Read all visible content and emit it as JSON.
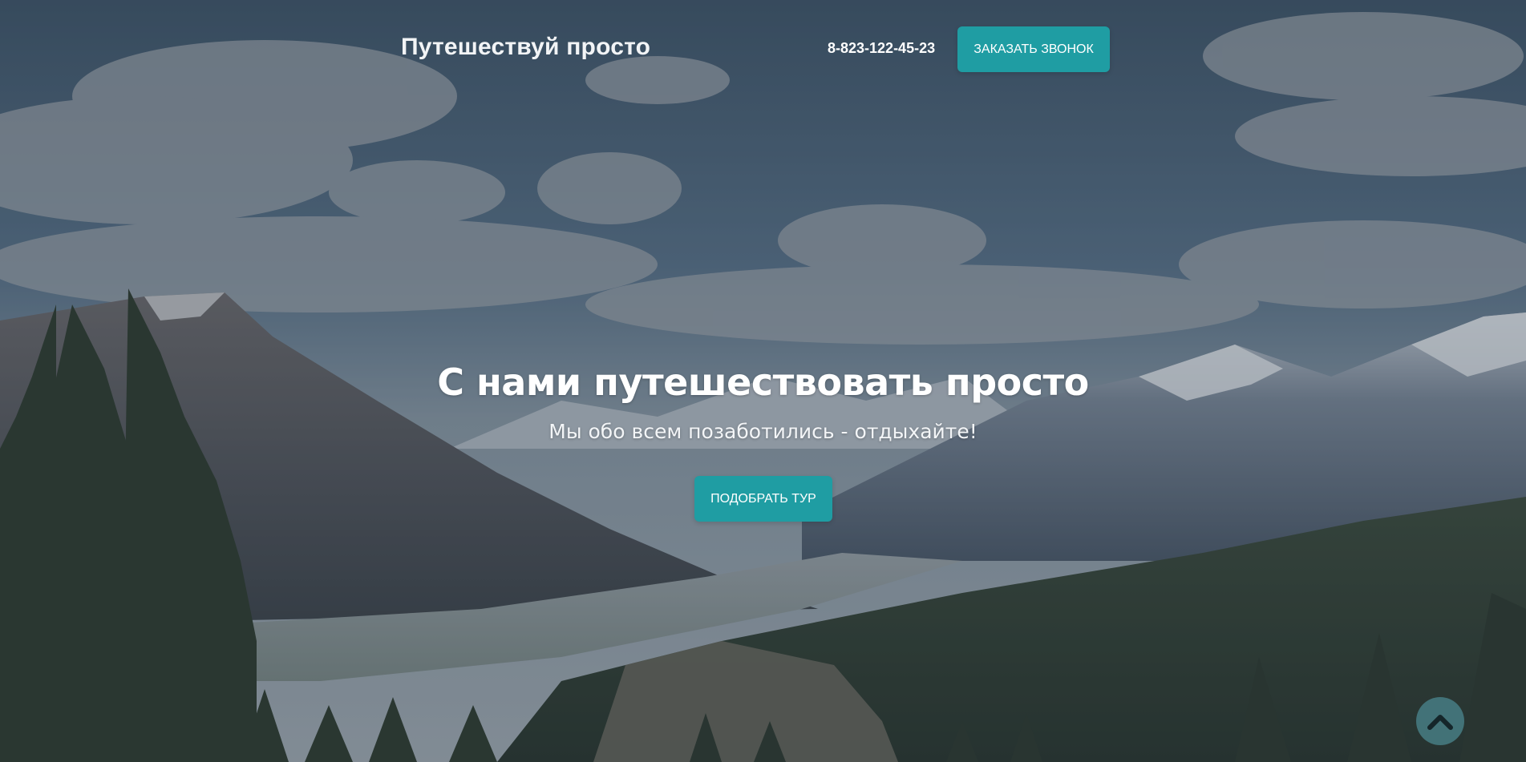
{
  "header": {
    "logo": "Путешествуй просто",
    "phone": "8-823-122-45-23",
    "call_button_label": "ЗАКАЗАТЬ ЗВОНОК"
  },
  "hero": {
    "title": "С нами путешествовать просто",
    "subtitle": "Мы обо всем позаботились - отдыхайте!",
    "cta_label": "ПОДОБРАТЬ ТУР"
  },
  "scroll_top": {
    "icon": "chevron-up-icon"
  },
  "colors": {
    "accent": "#1f9da3",
    "scroll_top_bg": "#488087",
    "text": "#ffffff"
  }
}
